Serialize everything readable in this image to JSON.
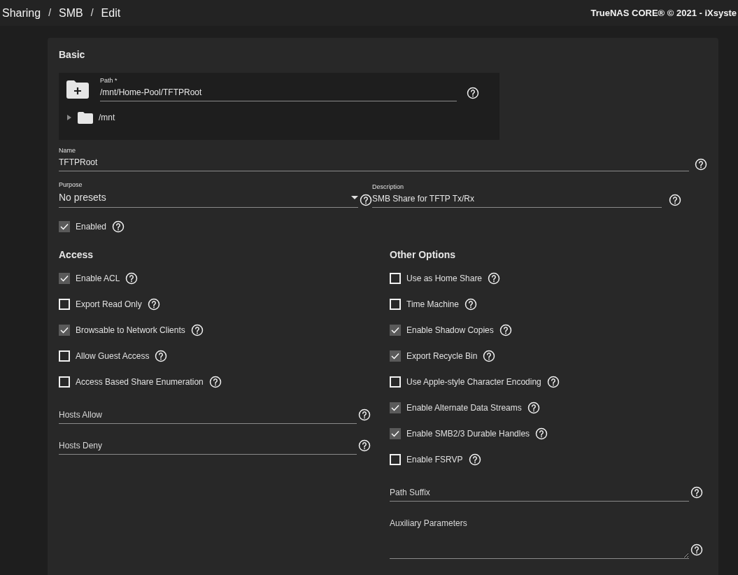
{
  "topbar": {
    "breadcrumbs": [
      {
        "kind": "crumb",
        "text": "Sharing"
      },
      {
        "kind": "separator",
        "text": "/"
      },
      {
        "kind": "crumb",
        "text": "SMB"
      },
      {
        "kind": "separator",
        "text": "/"
      },
      {
        "kind": "crumb",
        "text": "Edit"
      }
    ],
    "copyright": "TrueNAS CORE® © 2021 - iXsyste"
  },
  "basic": {
    "title": "Basic",
    "path": {
      "label": "Path *",
      "value": "/mnt/Home-Pool/TFTPRoot"
    },
    "tree": [
      {
        "label": "/mnt",
        "expanded": false
      }
    ],
    "name": {
      "label": "Name",
      "value": "TFTPRoot"
    },
    "purpose": {
      "label": "Purpose",
      "value": "No presets"
    },
    "description": {
      "label": "Description",
      "value": "SMB Share for TFTP Tx/Rx"
    },
    "enabled": {
      "label": "Enabled",
      "checked": true
    }
  },
  "access": {
    "title": "Access",
    "options": [
      {
        "label": "Enable ACL",
        "checked": true
      },
      {
        "label": "Export Read Only",
        "checked": false
      },
      {
        "label": "Browsable to Network Clients",
        "checked": true
      },
      {
        "label": "Allow Guest Access",
        "checked": false
      },
      {
        "label": "Access Based Share Enumeration",
        "checked": false
      }
    ],
    "fields": [
      {
        "kind": "input",
        "placeholder": "Hosts Allow"
      },
      {
        "kind": "input",
        "placeholder": "Hosts Deny"
      }
    ]
  },
  "other_options": {
    "title": "Other Options",
    "options": [
      {
        "label": "Use as Home Share",
        "checked": false
      },
      {
        "label": "Time Machine",
        "checked": false
      },
      {
        "label": "Enable Shadow Copies",
        "checked": true
      },
      {
        "label": "Export Recycle Bin",
        "checked": true
      },
      {
        "label": "Use Apple-style Character Encoding",
        "checked": false
      },
      {
        "label": "Enable Alternate Data Streams",
        "checked": true
      },
      {
        "label": "Enable SMB2/3 Durable Handles",
        "checked": true
      },
      {
        "label": "Enable FSRVP",
        "checked": false
      }
    ],
    "fields": [
      {
        "kind": "input",
        "placeholder": "Path Suffix"
      },
      {
        "kind": "textarea",
        "placeholder": "Auxiliary Parameters"
      }
    ]
  }
}
